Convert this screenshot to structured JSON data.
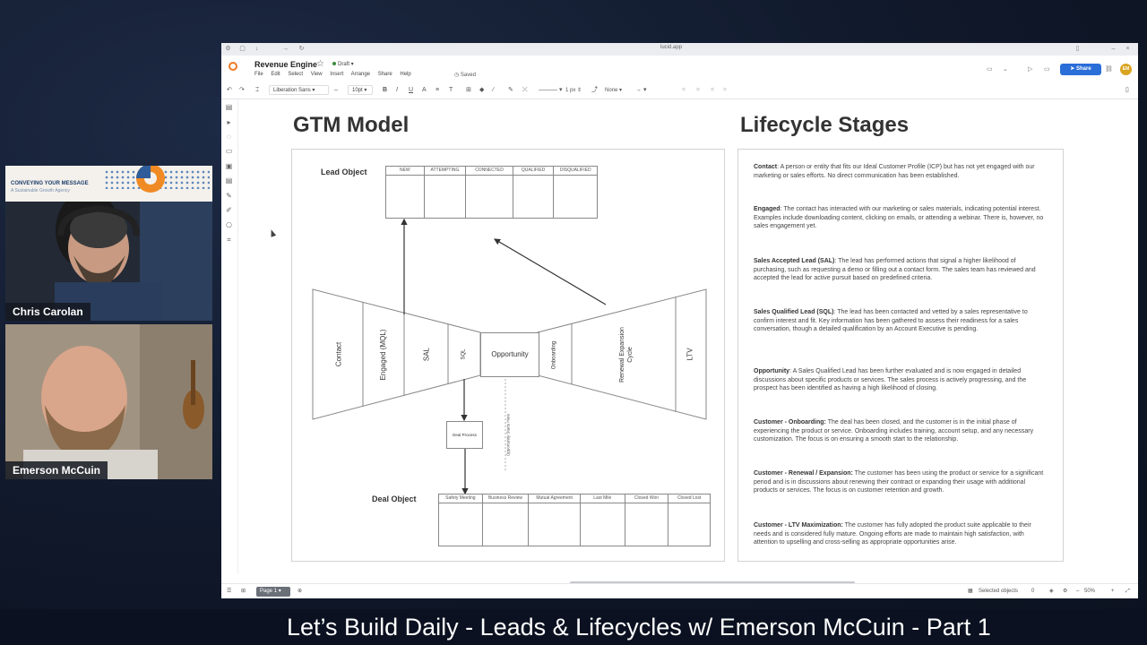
{
  "webcams": {
    "top_name": "Chris Carolan",
    "bottom_name": "Emerson McCuin",
    "logo_line1": "CONVEYING YOUR MESSAGE",
    "logo_line2": "A Sustainable Growth Agency"
  },
  "app": {
    "url": "lucid.app",
    "doc_title": "Revenue Engine",
    "status": "Draft",
    "menu": [
      "File",
      "Edit",
      "Select",
      "View",
      "Insert",
      "Arrange",
      "Share",
      "Help"
    ],
    "saved_label": "Saved",
    "share_label": "Share",
    "avatar_initials": "EM",
    "font_family_value": "Liberation Sans",
    "font_size_value": "10pt",
    "stroke_width_value": "1 px",
    "arrow_value": "None",
    "page_tab": "Page 1",
    "selected_objects_label": "Selected objects",
    "selected_count": "0",
    "zoom": "50%"
  },
  "canvas": {
    "gtm_title": "GTM Model",
    "lifecycle_title": "Lifecycle Stages",
    "lead_object_label": "Lead Object",
    "lead_columns": [
      "NEW",
      "ATTEMPTING",
      "CONNECTED",
      "QUALIFIED",
      "DISQUALIFIED"
    ],
    "deal_object_label": "Deal Object",
    "deal_columns": [
      "Safety Meeting",
      "Business Review",
      "Mutual Agreement",
      "Last Mile",
      "Closed Won",
      "Closed Lost"
    ],
    "left_funnel_stages": [
      "Contact",
      "Engaged (MQL)",
      "SAL",
      "SQL"
    ],
    "opportunity_label": "Opportunity",
    "right_funnel_stages": [
      "Onboarding",
      "Renewal Expansion Cycle",
      "LTV"
    ],
    "deal_process_label": "Deal Process",
    "opportunity_note": "Opportunity Starts Here"
  },
  "lifecycle": [
    {
      "term": "Contact",
      "desc": ": A person or entity that fits our Ideal Customer Profile (ICP) but has not yet engaged with our marketing or sales efforts. No direct communication has been established."
    },
    {
      "term": "Engaged",
      "desc": ": The contact has interacted with our marketing or sales materials, indicating potential interest. Examples include downloading content, clicking on emails, or attending a webinar. There is, however, no sales engagement yet."
    },
    {
      "term": "Sales Accepted Lead (SAL)",
      "desc": ": The lead has performed actions that signal a higher likelihood of purchasing, such as requesting a demo or filling out a contact form. The sales team has reviewed and accepted the lead for active pursuit based on predefined criteria."
    },
    {
      "term": "Sales Qualified Lead (SQL)",
      "desc": ": The lead has been contacted and vetted by a sales representative to confirm interest and fit. Key information has been gathered to assess their readiness for a sales conversation, though a detailed qualification by an Account Executive is pending."
    },
    {
      "term": "Opportunity",
      "desc": ": A Sales Qualified Lead has been further evaluated and is now engaged in detailed discussions about specific products or services. The sales process is actively progressing, and the prospect has been identified as having a high likelihood of closing."
    },
    {
      "term": "Customer - Onboarding:",
      "desc": " The deal has been closed, and the customer is in the initial phase of experiencing the product or service. Onboarding includes training, account setup, and any necessary customization. The focus is on ensuring a smooth start to the relationship."
    },
    {
      "term": "Customer - Renewal / Expansion:",
      "desc": " The customer has been using the product or service for a significant period and is in discussions about renewing their contract or expanding their usage with additional products or services. The focus is on customer retention and growth."
    },
    {
      "term": "Customer - LTV Maximization:",
      "desc": " The customer has fully adopted the product suite applicable to their needs and is considered fully mature. Ongoing efforts are made to maintain high satisfaction, with attention to upselling and cross-selling as appropriate opportunities arise."
    }
  ],
  "caption": "Let’s Build Daily - Leads & Lifecycles w/ Emerson McCuin - Part 1"
}
